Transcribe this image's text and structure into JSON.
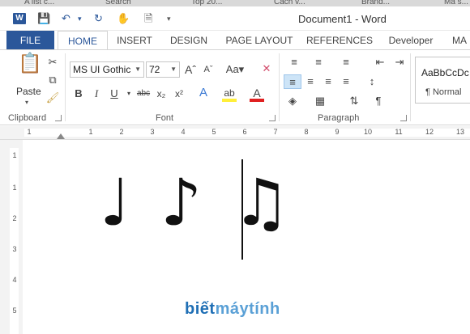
{
  "browser_tabs": [
    "A list c...",
    "Search",
    "Top 20...",
    "Cách v...",
    "Brand...",
    "Mã s..."
  ],
  "window": {
    "title": "Document1 - Word"
  },
  "ribbon_tabs": [
    {
      "label": "FILE"
    },
    {
      "label": "HOME"
    },
    {
      "label": "INSERT"
    },
    {
      "label": "DESIGN"
    },
    {
      "label": "PAGE LAYOUT"
    },
    {
      "label": "REFERENCES"
    },
    {
      "label": "Developer"
    },
    {
      "label": "MA"
    }
  ],
  "clipboard": {
    "paste_label": "Paste",
    "group_label": "Clipboard"
  },
  "font": {
    "name": "MS UI Gothic",
    "size": "72",
    "group_label": "Font"
  },
  "paragraph": {
    "group_label": "Paragraph"
  },
  "styles": {
    "sample": "AaBbCcDc",
    "name": "¶ Normal"
  },
  "ruler": {
    "numbers": [
      "1",
      "1",
      "2",
      "3",
      "4",
      "5",
      "6",
      "7",
      "8",
      "9",
      "10",
      "11",
      "12",
      "13"
    ]
  },
  "vruler": {
    "numbers": [
      "1",
      "1",
      "2",
      "3",
      "4",
      "5"
    ]
  },
  "document": {
    "content": "♩ ♪ ♫"
  },
  "watermark": {
    "part1": "biết",
    "part2": "máytính"
  }
}
